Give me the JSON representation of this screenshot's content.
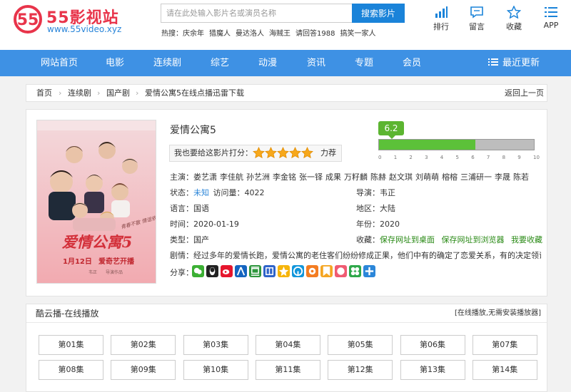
{
  "site": {
    "logo_mark": "55",
    "title": "55影视站",
    "url": "www.55video.xyz"
  },
  "search": {
    "placeholder": "请在此处输入影片名或演员名称",
    "button": "搜索影片"
  },
  "hot": {
    "label": "热搜：",
    "items": [
      "庆余年",
      "猎魔人",
      "曼达洛人",
      "海贼王",
      "请回答1988",
      "搞笑一家人"
    ]
  },
  "top_icons": [
    {
      "label": "排行",
      "icon": "bar-chart-icon"
    },
    {
      "label": "留言",
      "icon": "message-icon"
    },
    {
      "label": "收藏",
      "icon": "star-icon"
    },
    {
      "label": "APP",
      "icon": "list-icon"
    }
  ],
  "nav": {
    "items": [
      "网站首页",
      "电影",
      "连续剧",
      "综艺",
      "动漫",
      "资讯",
      "专题",
      "会员"
    ],
    "latest": "最近更新"
  },
  "breadcrumb": {
    "items": [
      "首页",
      "连续剧",
      "国产剧",
      "爱情公寓5在线点播迅雷下载"
    ],
    "back": "返回上一页"
  },
  "movie": {
    "title": "爱情公寓5",
    "rate_label": "我也要给这影片打分：",
    "rating_stars": 5,
    "recommend": "力荐",
    "score": "6.2",
    "score_value": 6.2,
    "score_max": 10,
    "score_ticks": [
      "0",
      "1",
      "2",
      "3",
      "4",
      "5",
      "6",
      "7",
      "8",
      "9",
      "10"
    ],
    "cast_label": "主演：",
    "cast": [
      "娄艺潇",
      "李佳航",
      "孙艺洲",
      "李金铭",
      "张一铎",
      "成果",
      "万籽麟",
      "陈赫",
      "赵文琪",
      "刘萌萌",
      "榕榕",
      "三浦研一",
      "李晟",
      "陈若"
    ],
    "status_label": "状态：",
    "status": "未知",
    "views_label": "访问量：",
    "views": "4022",
    "director_label": "导演：",
    "director": "韦正",
    "language_label": "语言：",
    "language": "国语",
    "region_label": "地区：",
    "region": "大陆",
    "time_label": "时间：",
    "time": "2020-01-19",
    "year_label": "年份：",
    "year": "2020",
    "type_label": "类型：",
    "type": "国产",
    "fav_label": "收藏：",
    "fav_links": [
      "保存网址到桌面",
      "保存网址到浏览器",
      "我要收藏"
    ],
    "plot_label": "剧情：",
    "plot": "经过多年的爱情长跑，爱情公寓的老住客们纷纷修成正果，他们中有的确定了恋爱关系，有的决定领证结婚",
    "share_label": "分享：",
    "poster": {
      "title_art": "爱情公寓5",
      "release": "1月12日",
      "platform": "爱奇艺开播",
      "credit": "韦正",
      "credit2": "导演作品",
      "tagline": "青春不散 情谊依旧"
    }
  },
  "share_icons": [
    {
      "name": "wechat-icon",
      "color": "#3cb034"
    },
    {
      "name": "qq-icon",
      "color": "#222222"
    },
    {
      "name": "weibo-icon",
      "color": "#e6162d"
    },
    {
      "name": "renren-icon",
      "color": "#1565c0"
    },
    {
      "name": "douban-icon",
      "color": "#2e963d"
    },
    {
      "name": "tieba-icon",
      "color": "#2f64c9"
    },
    {
      "name": "qzone-icon",
      "color": "#f6b50b"
    },
    {
      "name": "alipay-icon",
      "color": "#1296db"
    },
    {
      "name": "kaixin-icon",
      "color": "#f47d22"
    },
    {
      "name": "bookmark-icon",
      "color": "#f5a623"
    },
    {
      "name": "pengyou-icon",
      "color": "#f05b72"
    },
    {
      "name": "clover-icon",
      "color": "#2ea84a"
    },
    {
      "name": "more-icon",
      "color": "#2b86d9"
    }
  ],
  "play": {
    "title": "酷云播-在线播放",
    "note": "[在线播放,无需安装播放器]",
    "episodes": [
      "第01集",
      "第02集",
      "第03集",
      "第04集",
      "第05集",
      "第06集",
      "第07集",
      "第08集",
      "第09集",
      "第10集",
      "第11集",
      "第12集",
      "第13集",
      "第14集"
    ]
  },
  "colors": {
    "brand_red": "#e8344a",
    "nav_blue": "#3e91e4",
    "score_green": "#5cb531",
    "link_blue": "#2b86d9"
  }
}
